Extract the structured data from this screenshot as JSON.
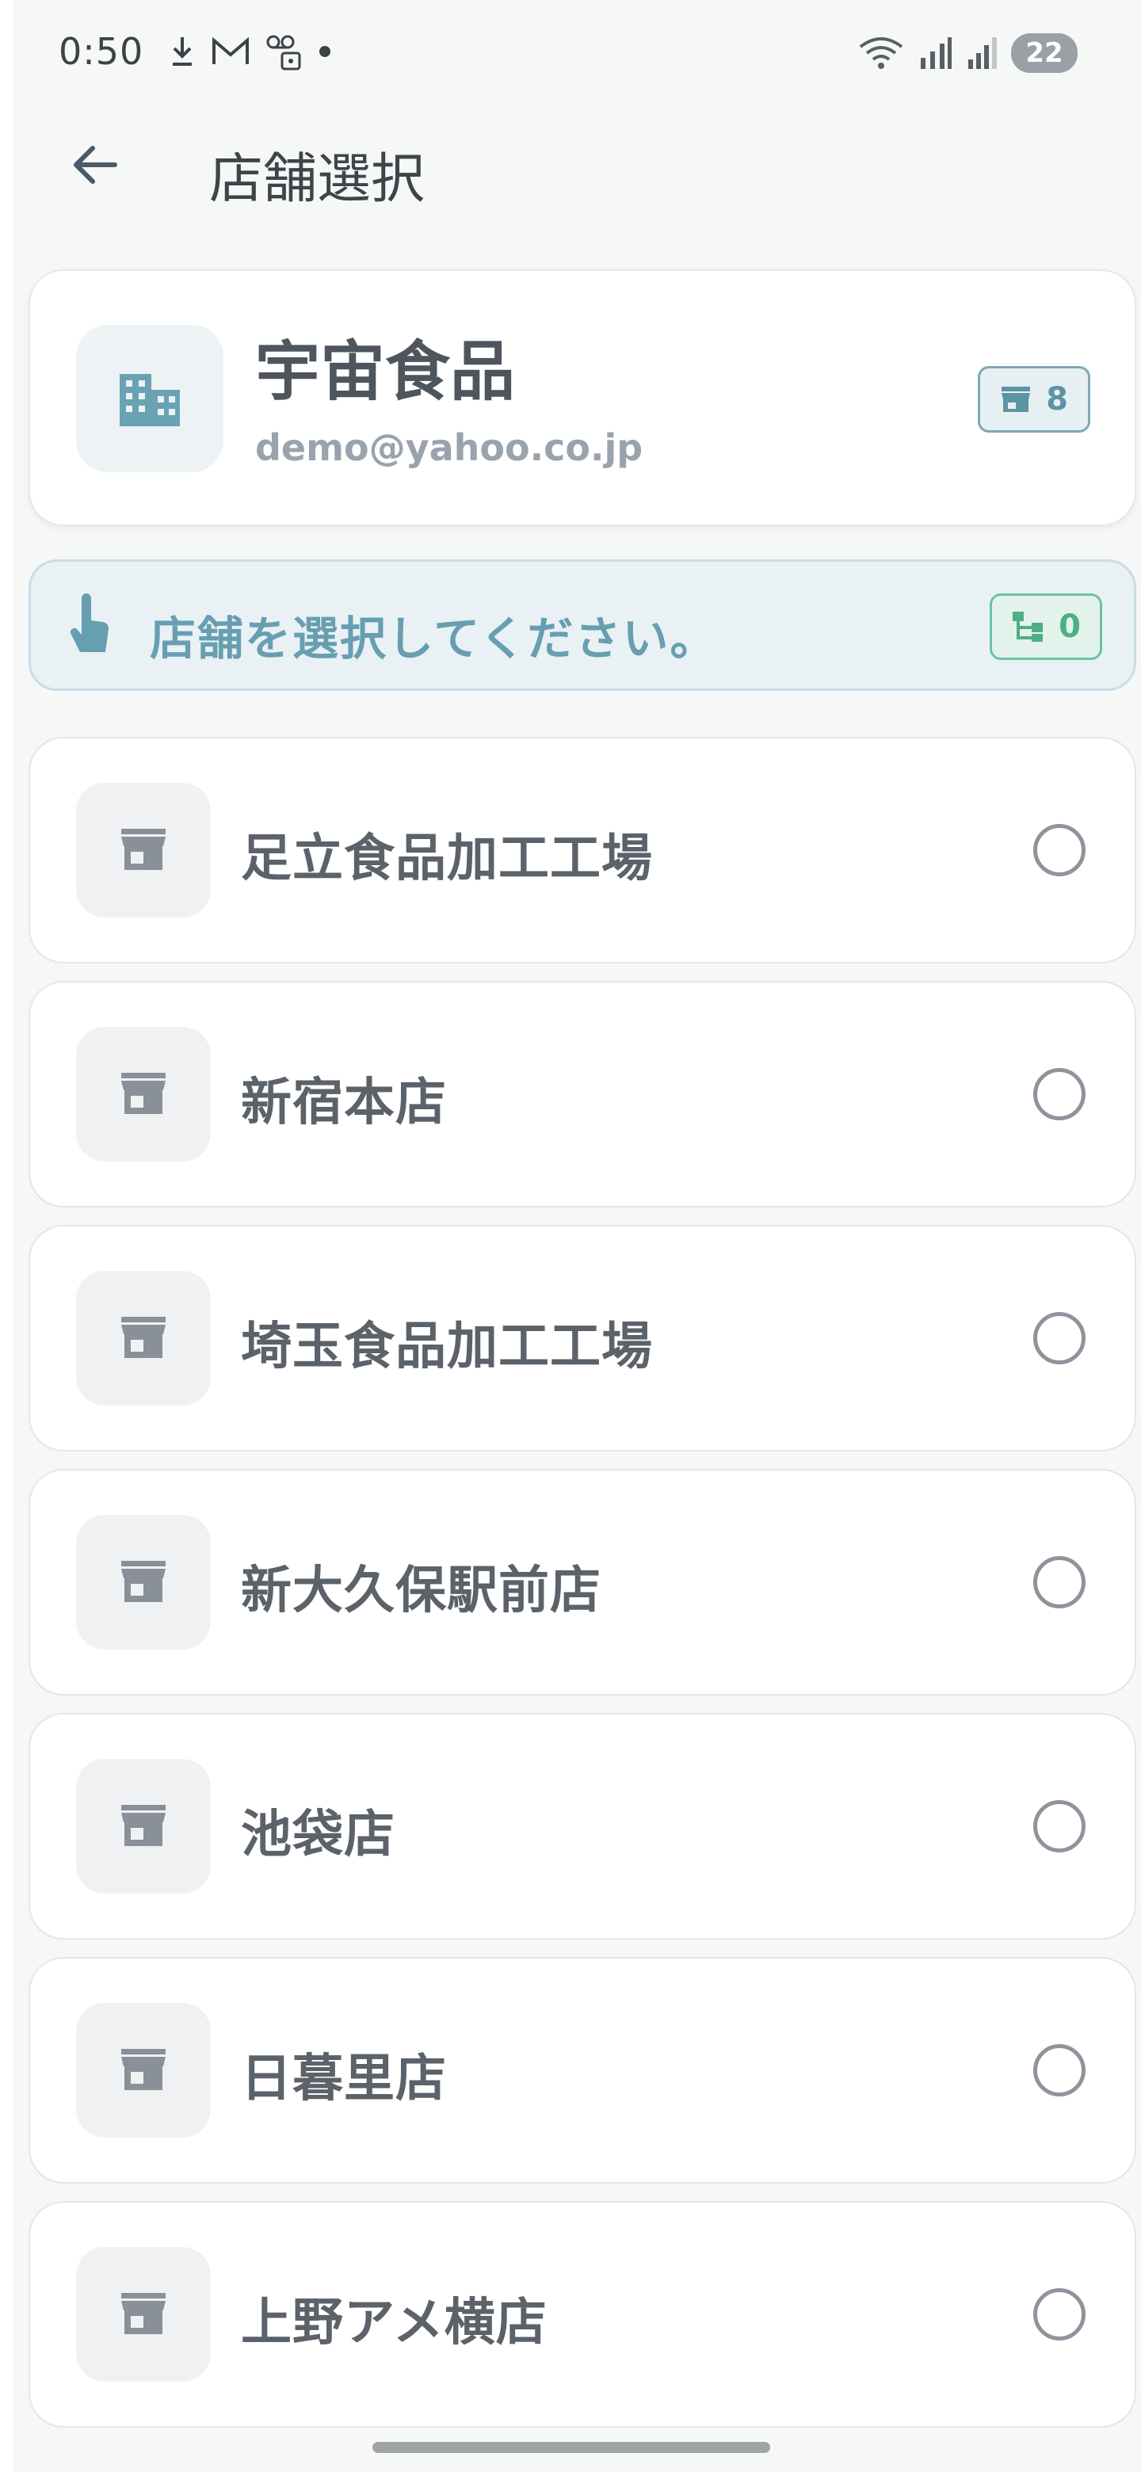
{
  "status_bar": {
    "time": "0:50",
    "icons_left": [
      "download-icon",
      "gmail-icon",
      "voicemail-icon",
      "dot-icon"
    ],
    "icons_right": [
      "wifi-icon",
      "signal-r-icon",
      "signal-icon"
    ],
    "battery": "22"
  },
  "header": {
    "back_icon": "arrow-left-icon",
    "title": "店舗選択"
  },
  "company": {
    "icon": "building-icon",
    "name": "宇宙食品",
    "email": "demo@yahoo.co.jp",
    "store_count": "8"
  },
  "prompt": {
    "icon": "touch-icon",
    "text": "店舗を選択してください。",
    "selected_count": "0"
  },
  "stores": [
    {
      "name": "足立食品加工工場",
      "selected": false
    },
    {
      "name": "新宿本店",
      "selected": false
    },
    {
      "name": "埼玉食品加工工場",
      "selected": false
    },
    {
      "name": "新大久保駅前店",
      "selected": false
    },
    {
      "name": "池袋店",
      "selected": false
    },
    {
      "name": "日暮里店",
      "selected": false
    },
    {
      "name": "上野アメ横店",
      "selected": false
    }
  ],
  "colors": {
    "accent": "#679fb1",
    "selected_badge": "#4eae87",
    "text": "#5c6269",
    "background": "#f6f8f8"
  }
}
